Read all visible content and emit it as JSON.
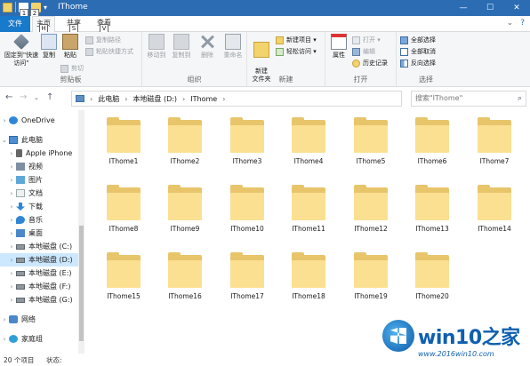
{
  "window": {
    "title": "IThome",
    "qat_keytips": [
      "1",
      "2"
    ],
    "controls": [
      "—",
      "☐",
      "✕"
    ]
  },
  "tabs": {
    "file": "文件",
    "items": [
      {
        "label": "主页",
        "keytip": "H",
        "active": true
      },
      {
        "label": "共享",
        "keytip": "S",
        "active": false
      },
      {
        "label": "查看",
        "keytip": "V",
        "active": false
      }
    ]
  },
  "ribbon": {
    "clipboard": {
      "label": "剪贴板",
      "pin": "固定到\"快速访问\"",
      "copy": "复制",
      "paste": "粘贴",
      "copy_path": "复制路径",
      "paste_shortcut": "粘贴快捷方式",
      "cut": "剪切"
    },
    "organize": {
      "label": "组织",
      "move_to": "移动到",
      "copy_to": "复制到",
      "delete": "删除",
      "rename": "重命名"
    },
    "new": {
      "label": "新建",
      "new_folder": "新建\n文件夹",
      "new_item": "新建项目 ▾",
      "easy_access": "轻松访问 ▾"
    },
    "open": {
      "label": "打开",
      "properties": "属性",
      "open": "打开 ▾",
      "edit": "编辑",
      "history": "历史记录"
    },
    "select": {
      "label": "选择",
      "select_all": "全部选择",
      "select_none": "全部取消",
      "invert": "反向选择"
    }
  },
  "address": {
    "crumbs": [
      "此电脑",
      "本地磁盘 (D:)",
      "IThome"
    ],
    "search_placeholder": "搜索\"IThome\""
  },
  "navpane": {
    "items": [
      {
        "label": "OneDrive",
        "icon": "onedrive-icon",
        "indent": 0
      },
      {
        "label": "此电脑",
        "icon": "pc-icon",
        "indent": 0,
        "expanded": true
      },
      {
        "label": "Apple iPhone",
        "icon": "phone-icon",
        "indent": 1
      },
      {
        "label": "视频",
        "icon": "video-icon",
        "indent": 1
      },
      {
        "label": "图片",
        "icon": "pictures-icon",
        "indent": 1
      },
      {
        "label": "文档",
        "icon": "documents-icon",
        "indent": 1
      },
      {
        "label": "下载",
        "icon": "download-icon",
        "indent": 1
      },
      {
        "label": "音乐",
        "icon": "music-icon",
        "indent": 1
      },
      {
        "label": "桌面",
        "icon": "desktop-icon",
        "indent": 1
      },
      {
        "label": "本地磁盘 (C:)",
        "icon": "disk-icon",
        "indent": 1
      },
      {
        "label": "本地磁盘 (D:)",
        "icon": "disk-icon",
        "indent": 1,
        "selected": true
      },
      {
        "label": "本地磁盘 (E:)",
        "icon": "disk-icon",
        "indent": 1
      },
      {
        "label": "本地磁盘 (F:)",
        "icon": "disk-icon",
        "indent": 1
      },
      {
        "label": "本地磁盘 (G:)",
        "icon": "disk-icon",
        "indent": 1
      },
      {
        "label": "网络",
        "icon": "network-icon",
        "indent": 0
      },
      {
        "label": "家庭组",
        "icon": "homegroup-icon",
        "indent": 0
      }
    ]
  },
  "folders": [
    "IThome1",
    "IThome2",
    "IThome3",
    "IThome4",
    "IThome5",
    "IThome6",
    "IThome7",
    "IThome8",
    "IThome9",
    "IThome10",
    "IThome11",
    "IThome12",
    "IThome13",
    "IThome14",
    "IThome15",
    "IThome16",
    "IThome17",
    "IThome18",
    "IThome19",
    "IThome20"
  ],
  "status": {
    "count": "20 个项目",
    "state": "状态:"
  },
  "watermark": {
    "brand": "win10之家",
    "url": "www.2016win10.com"
  },
  "colors": {
    "titlebar": "#2b6cb3",
    "file_tab": "#1979ca",
    "selection": "#cce8ff",
    "folder": "#fbe091"
  }
}
